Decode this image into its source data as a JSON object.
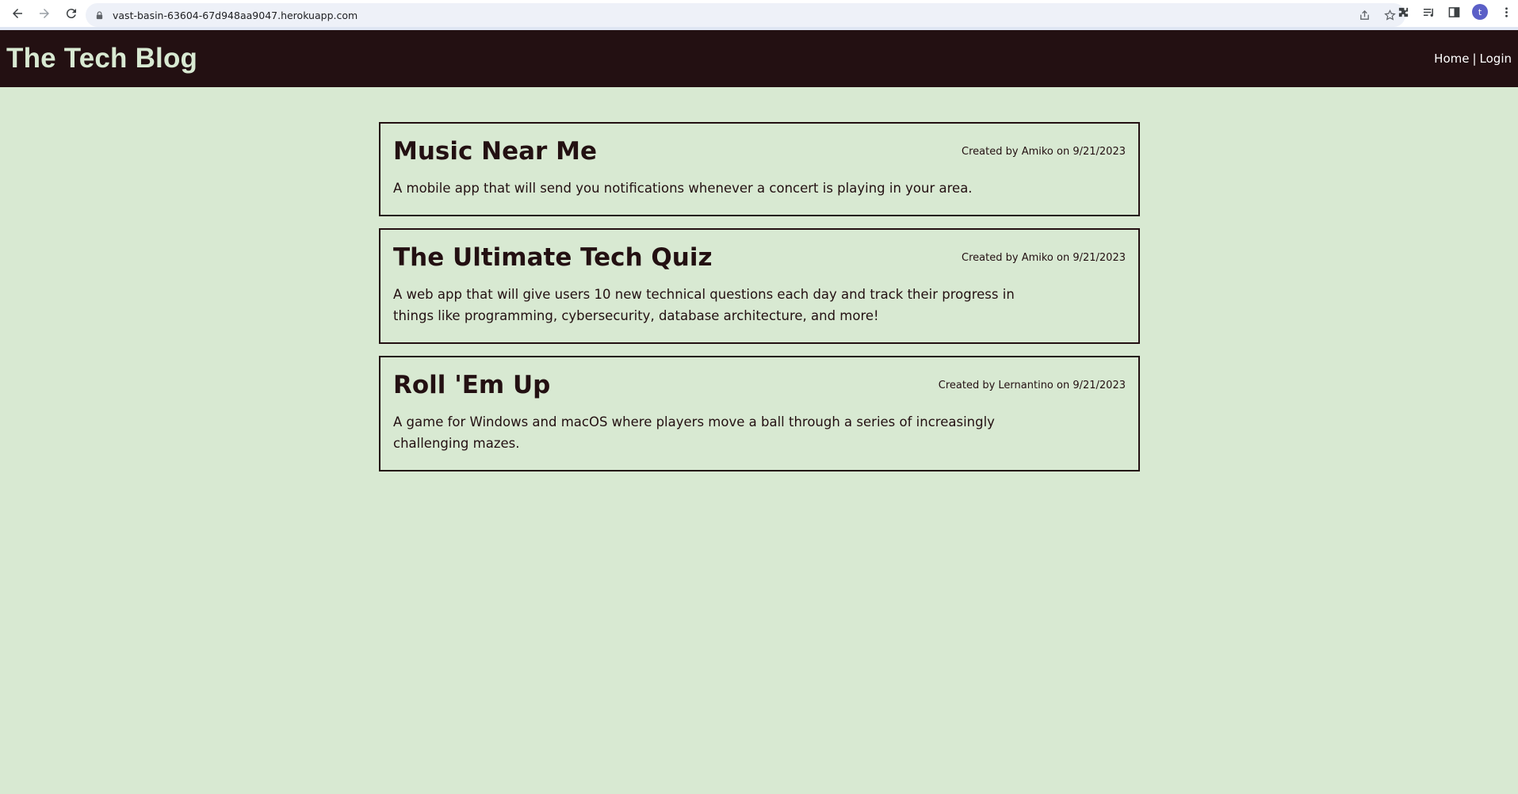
{
  "browser": {
    "url": "vast-basin-63604-67d948aa9047.herokuapp.com",
    "avatar_letter": "t"
  },
  "header": {
    "title": "The Tech Blog",
    "nav_home": "Home",
    "nav_sep": "|",
    "nav_login": "Login"
  },
  "posts": [
    {
      "title": "Music Near Me",
      "meta": "Created by Amiko on 9/21/2023",
      "body": "A mobile app that will send you notifications whenever a concert is playing in your area."
    },
    {
      "title": "The Ultimate Tech Quiz",
      "meta": "Created by Amiko on 9/21/2023",
      "body": "A web app that will give users 10 new technical questions each day and track their progress in things like programming, cybersecurity, database architecture, and more!"
    },
    {
      "title": "Roll 'Em Up",
      "meta": "Created by Lernantino on 9/21/2023",
      "body": "A game for Windows and macOS where players move a ball through a series of increasingly challenging mazes."
    }
  ],
  "colors": {
    "header_bg": "#231012",
    "page_bg": "#d8e9d2",
    "title_color": "#d8e9d2"
  }
}
